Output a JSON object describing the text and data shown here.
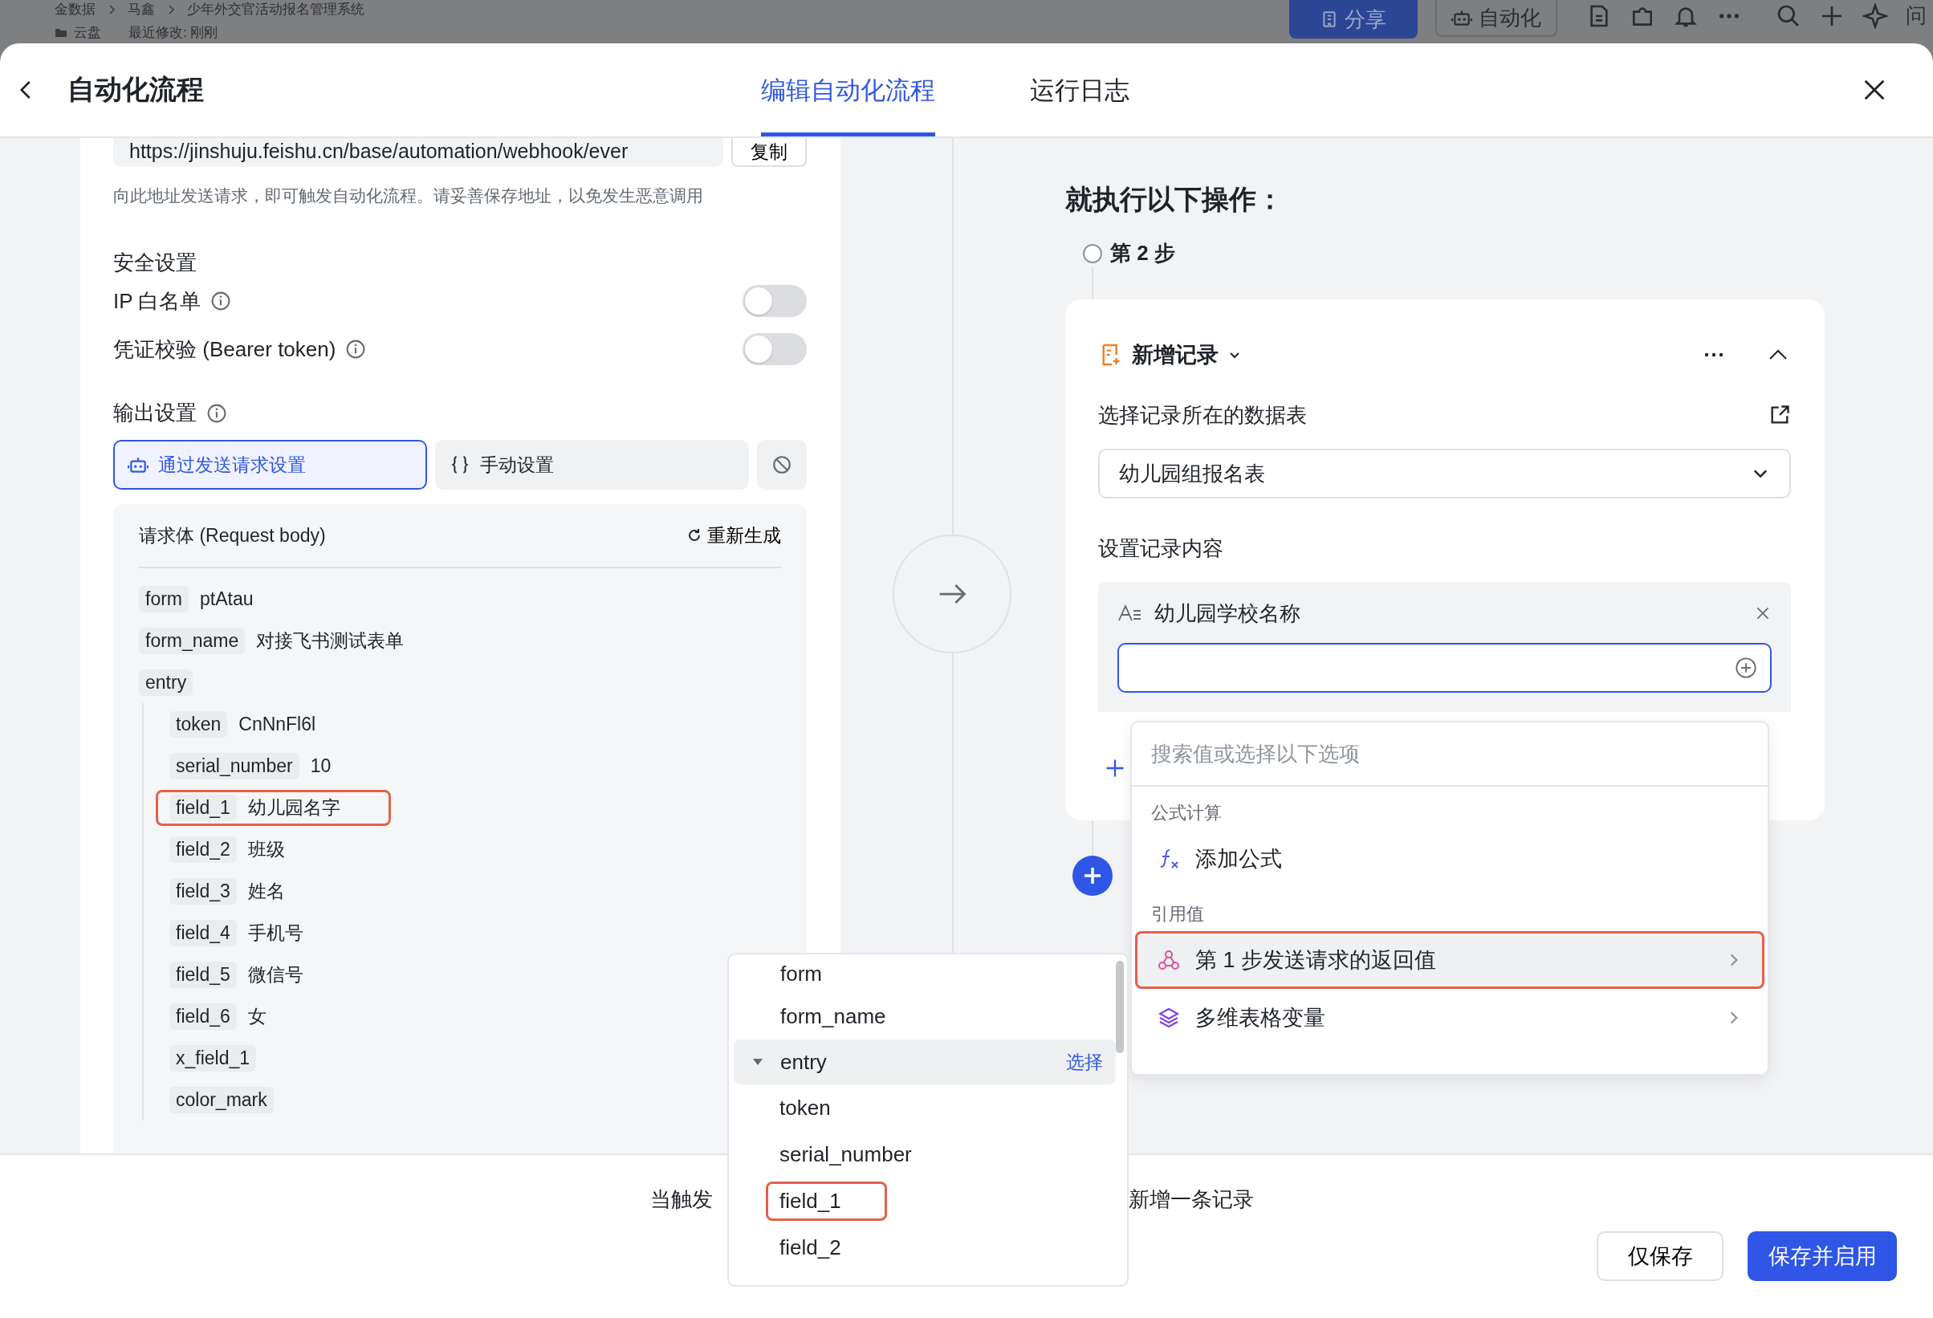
{
  "background_bar": {
    "breadcrumb": [
      "金数据",
      "马鑫",
      "少年外交官活动报名管理系统"
    ],
    "location": "云盘",
    "modified": "最近修改: 刚刚",
    "share_button": "分享",
    "automation_button": "自动化",
    "cut_label": "问"
  },
  "dialog": {
    "title": "自动化流程",
    "tabs": [
      {
        "label": "编辑自动化流程",
        "selected": true
      },
      {
        "label": "运行日志",
        "selected": false
      }
    ]
  },
  "trigger": {
    "webhook_url": "https://jinshuju.feishu.cn/base/automation/webhook/ever",
    "copy_button": "复制",
    "hint": "向此地址发送请求，即可触发自动化流程。请妥善保存地址，以免发生恶意调用",
    "security_heading": "安全设置",
    "security_options": [
      {
        "label": "IP 白名单",
        "on": false
      },
      {
        "label": "凭证校验 (Bearer token)",
        "on": false
      }
    ],
    "output_heading": "输出设置",
    "output_modes": [
      {
        "kind": "request",
        "label": "通过发送请求设置",
        "selected": true
      },
      {
        "kind": "manual",
        "label": "手动设置",
        "selected": false
      },
      {
        "kind": "none",
        "selected": false
      }
    ],
    "request_body": {
      "title": "请求体 (Request body)",
      "regenerate": "重新生成",
      "fields": [
        {
          "key": "form",
          "value": "ptAtau",
          "highlighted": false
        },
        {
          "key": "form_name",
          "value": "对接飞书测试表单",
          "highlighted": false
        },
        {
          "key": "entry",
          "highlighted": false,
          "children": [
            {
              "key": "token",
              "value": "CnNnFl6l",
              "highlighted": false
            },
            {
              "key": "serial_number",
              "value": "10",
              "highlighted": false
            },
            {
              "key": "field_1",
              "value": "幼儿园名字",
              "highlighted": true
            },
            {
              "key": "field_2",
              "value": "班级",
              "highlighted": false
            },
            {
              "key": "field_3",
              "value": "姓名",
              "highlighted": false
            },
            {
              "key": "field_4",
              "value": "手机号",
              "highlighted": false
            },
            {
              "key": "field_5",
              "value": "微信号",
              "highlighted": false
            },
            {
              "key": "field_6",
              "value": "女",
              "highlighted": false
            },
            {
              "key": "x_field_1",
              "highlighted": false
            },
            {
              "key": "color_mark",
              "highlighted": false
            }
          ]
        }
      ]
    }
  },
  "action": {
    "heading": "就执行以下操作：",
    "step": "第 2 步",
    "title": "新增记录",
    "table_label": "选择记录所在的数据表",
    "table_value": "幼儿园组报名表",
    "content_label": "设置记录内容",
    "field_name": "幼儿园学校名称"
  },
  "value_menu": {
    "placeholder": "搜索值或选择以下选项",
    "groups": [
      {
        "title": "公式计算",
        "items": [
          {
            "kind": "formula",
            "label": "添加公式",
            "highlighted": false,
            "submenu": false
          }
        ]
      },
      {
        "title": "引用值",
        "items": [
          {
            "kind": "webhook",
            "label": "第 1 步发送请求的返回值",
            "highlighted": true,
            "submenu": true
          },
          {
            "kind": "variables",
            "label": "多维表格变量",
            "highlighted": false,
            "submenu": true
          }
        ]
      }
    ]
  },
  "tree_menu": {
    "items": [
      {
        "label": "form",
        "selected": false
      },
      {
        "label": "form_name",
        "selected": false
      },
      {
        "label": "entry",
        "selected": true,
        "expanded": true,
        "action": "选择",
        "children": [
          {
            "label": "token",
            "highlighted": false
          },
          {
            "label": "serial_number",
            "highlighted": false
          },
          {
            "label": "field_1",
            "highlighted": true
          },
          {
            "label": "field_2",
            "highlighted": false
          }
        ]
      }
    ]
  },
  "footer": {
    "summary_start": "当触发",
    "summary_end": "新增一条记录",
    "save_button": "仅保存",
    "save_enable_button": "保存并启用"
  }
}
